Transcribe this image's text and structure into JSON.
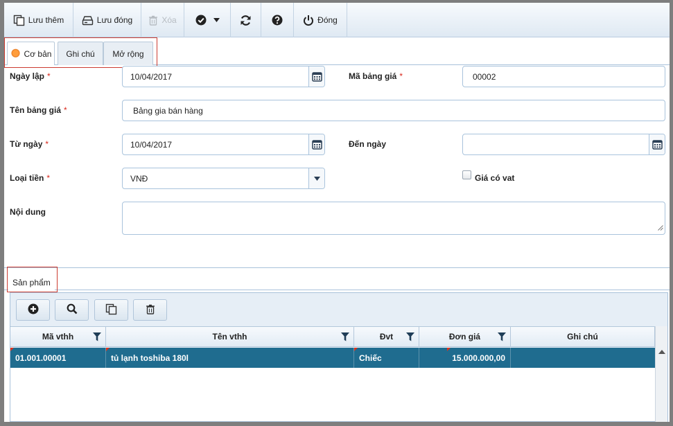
{
  "toolbar": {
    "save_add": "Lưu thêm",
    "save_close": "Lưu đóng",
    "delete": "Xóa",
    "close": "Đóng"
  },
  "tabs": [
    "Cơ bản",
    "Ghi chú",
    "Mở rộng"
  ],
  "form": {
    "ngay_lap": {
      "label": "Ngày lập",
      "required": "*",
      "value": "10/04/2017"
    },
    "ma_bang_gia": {
      "label": "Mã bảng giá",
      "required": "*",
      "value": "00002"
    },
    "ten_bang_gia": {
      "label": "Tên bảng giá",
      "required": "*",
      "value": "Bảng gia bán hàng"
    },
    "tu_ngay": {
      "label": "Từ ngày",
      "required": "*",
      "value": "10/04/2017"
    },
    "den_ngay": {
      "label": "Đến ngày",
      "value": ""
    },
    "loai_tien": {
      "label": "Loại tiền",
      "required": "*",
      "value": "VNĐ"
    },
    "gia_co_vat": {
      "label": "Giá có vat",
      "checked": false
    },
    "noi_dung": {
      "label": "Nội dung",
      "value": ""
    }
  },
  "section_tab": "Sản phẩm",
  "grid": {
    "columns": [
      "Mã vthh",
      "Tên vthh",
      "Đvt",
      "Đơn giá",
      "Ghi chú"
    ],
    "rows": [
      {
        "ma_vthh": "01.001.00001",
        "ten_vthh": "tủ lạnh toshiba 180l",
        "dvt": "Chiếc",
        "don_gia": "15.000.000,00",
        "ghi_chu": ""
      }
    ]
  },
  "colors": {
    "accent_selected_row": "#1f6c8f",
    "required_mark": "#d9281c",
    "highlight_frame": "#cc3b30",
    "active_tab_radio": "#f08a24"
  }
}
